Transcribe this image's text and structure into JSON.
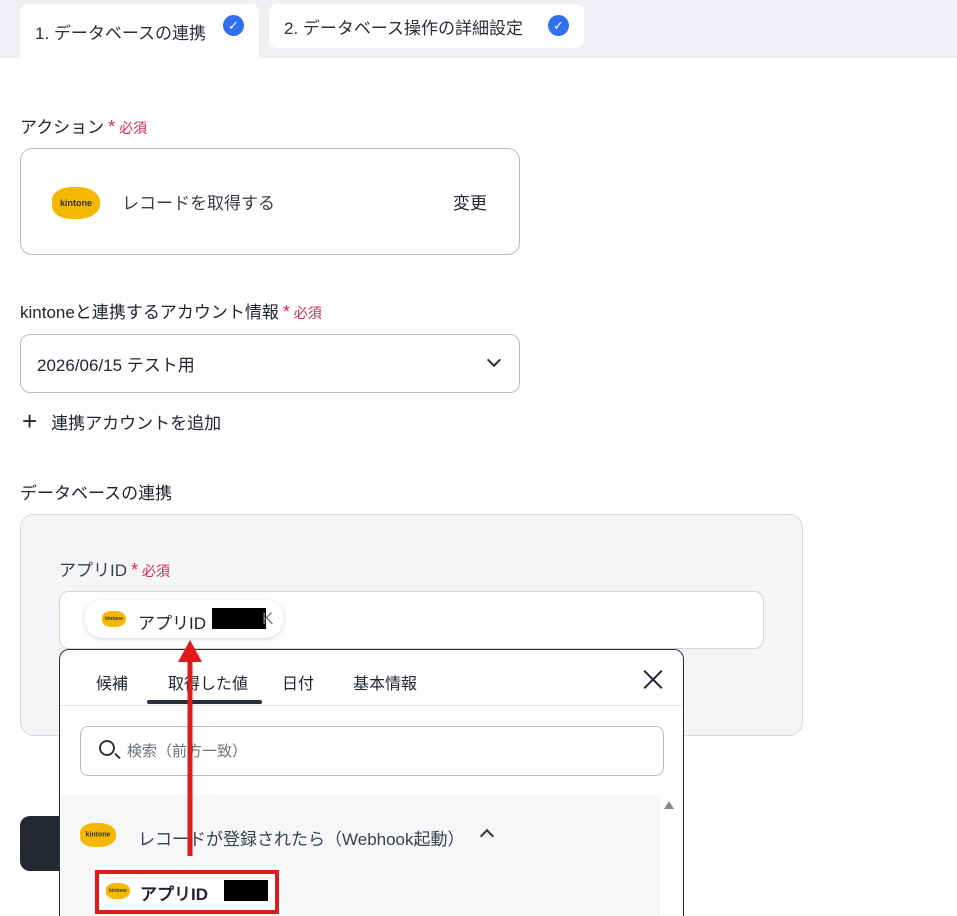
{
  "tabs": [
    {
      "label": "1. データベースの連携",
      "done": true
    },
    {
      "label": "2. データベース操作の詳細設定",
      "done": true
    }
  ],
  "action": {
    "label": "アクション",
    "required": "必須",
    "app_logo_text": "kintone",
    "value": "レコードを取得する",
    "change": "変更"
  },
  "account": {
    "label": "kintoneと連携するアカウント情報",
    "required": "必須",
    "selected": "2026/06/15 テスト用",
    "add_link": "連携アカウントを追加"
  },
  "database": {
    "section_title": "データベースの連携",
    "app_id_label": "アプリID",
    "required": "必須",
    "chip": {
      "logo_text": "kintone",
      "label": "アプリID",
      "suffix": "K"
    }
  },
  "popup": {
    "tabs": [
      "候補",
      "取得した値",
      "日付",
      "基本情報"
    ],
    "active_tab": "取得した値",
    "search_placeholder": "検索（前方一致）",
    "group": {
      "logo_text": "kintone",
      "label": "レコードが登録されたら（Webhook起動）"
    },
    "item": {
      "logo_text": "kintone",
      "label": "アプリID"
    }
  },
  "colors": {
    "accent": "#2f6ff0",
    "required": "#e0245e",
    "annotation": "#e01b1b",
    "kintone": "#f5b800"
  }
}
